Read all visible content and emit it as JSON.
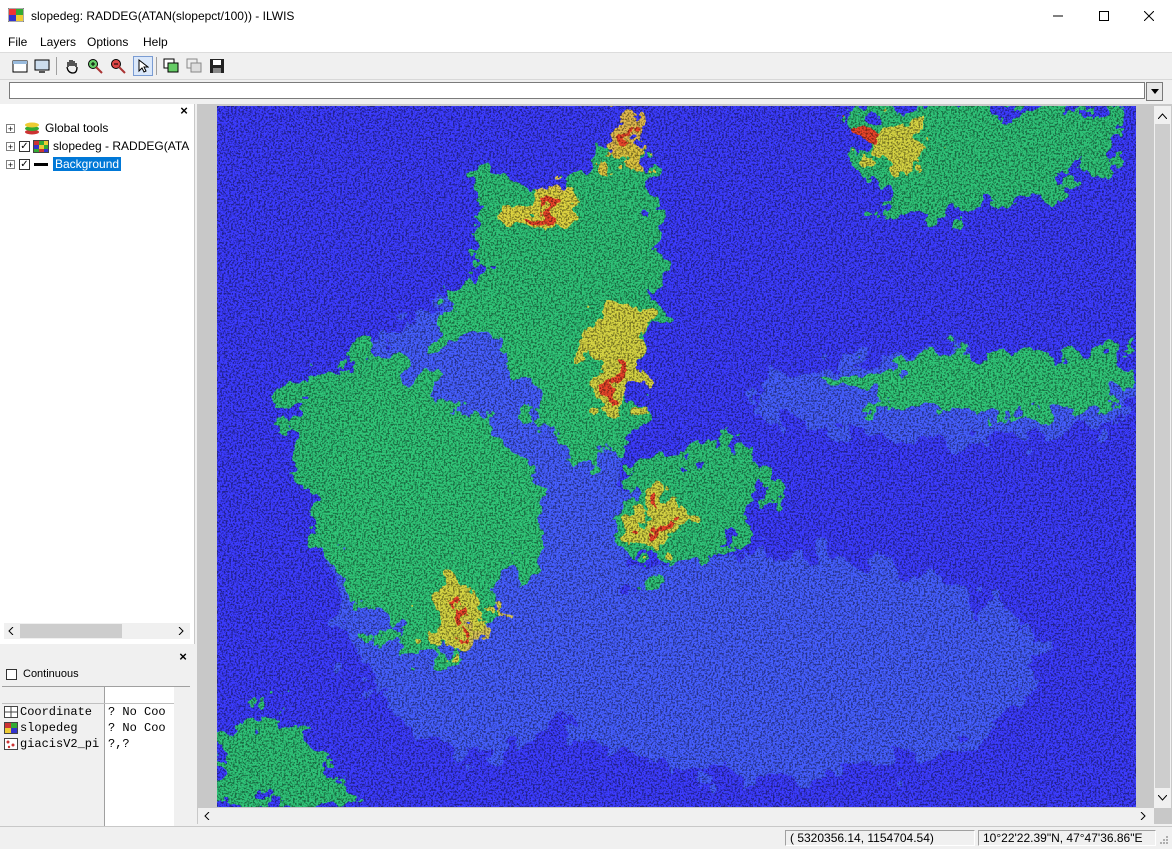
{
  "window": {
    "title": "slopedeg: RADDEG(ATAN(slopepct/100)) - ILWIS",
    "minimize": "—",
    "maximize": "☐",
    "close": "✕"
  },
  "menu": [
    "File",
    "Layers",
    "Options",
    "Help"
  ],
  "command": {
    "value": ""
  },
  "layers": [
    {
      "label": "Global tools",
      "checked": false
    },
    {
      "label": "slopedeg - RADDEG(ATA",
      "checked": true
    },
    {
      "label": "Background",
      "checked": true
    }
  ],
  "pixel_info": {
    "continuous_label": "Continuous",
    "rows": [
      {
        "name": "Coordinate",
        "value": "? No Coo"
      },
      {
        "name": "slopedeg",
        "value": "? No Coo"
      },
      {
        "name": "giacisV2_pi",
        "value": "?,?"
      }
    ]
  },
  "status": {
    "xy": "( 5320356.14,  1154704.54)",
    "latlon": "10°22'22.39\"N, 47°47'36.86\"E"
  },
  "icons": {
    "new": "new-window-icon",
    "display": "display-icon",
    "pan": "pan-hand-icon",
    "zoom_in": "zoom-in-icon",
    "zoom_out": "zoom-out-icon",
    "select": "pointer-icon",
    "add_layer": "add-layer-icon",
    "remove_layer": "remove-layer-icon",
    "save": "save-icon"
  },
  "colors": {
    "map_background": "#3c3cff",
    "selection": "#0078d7"
  }
}
